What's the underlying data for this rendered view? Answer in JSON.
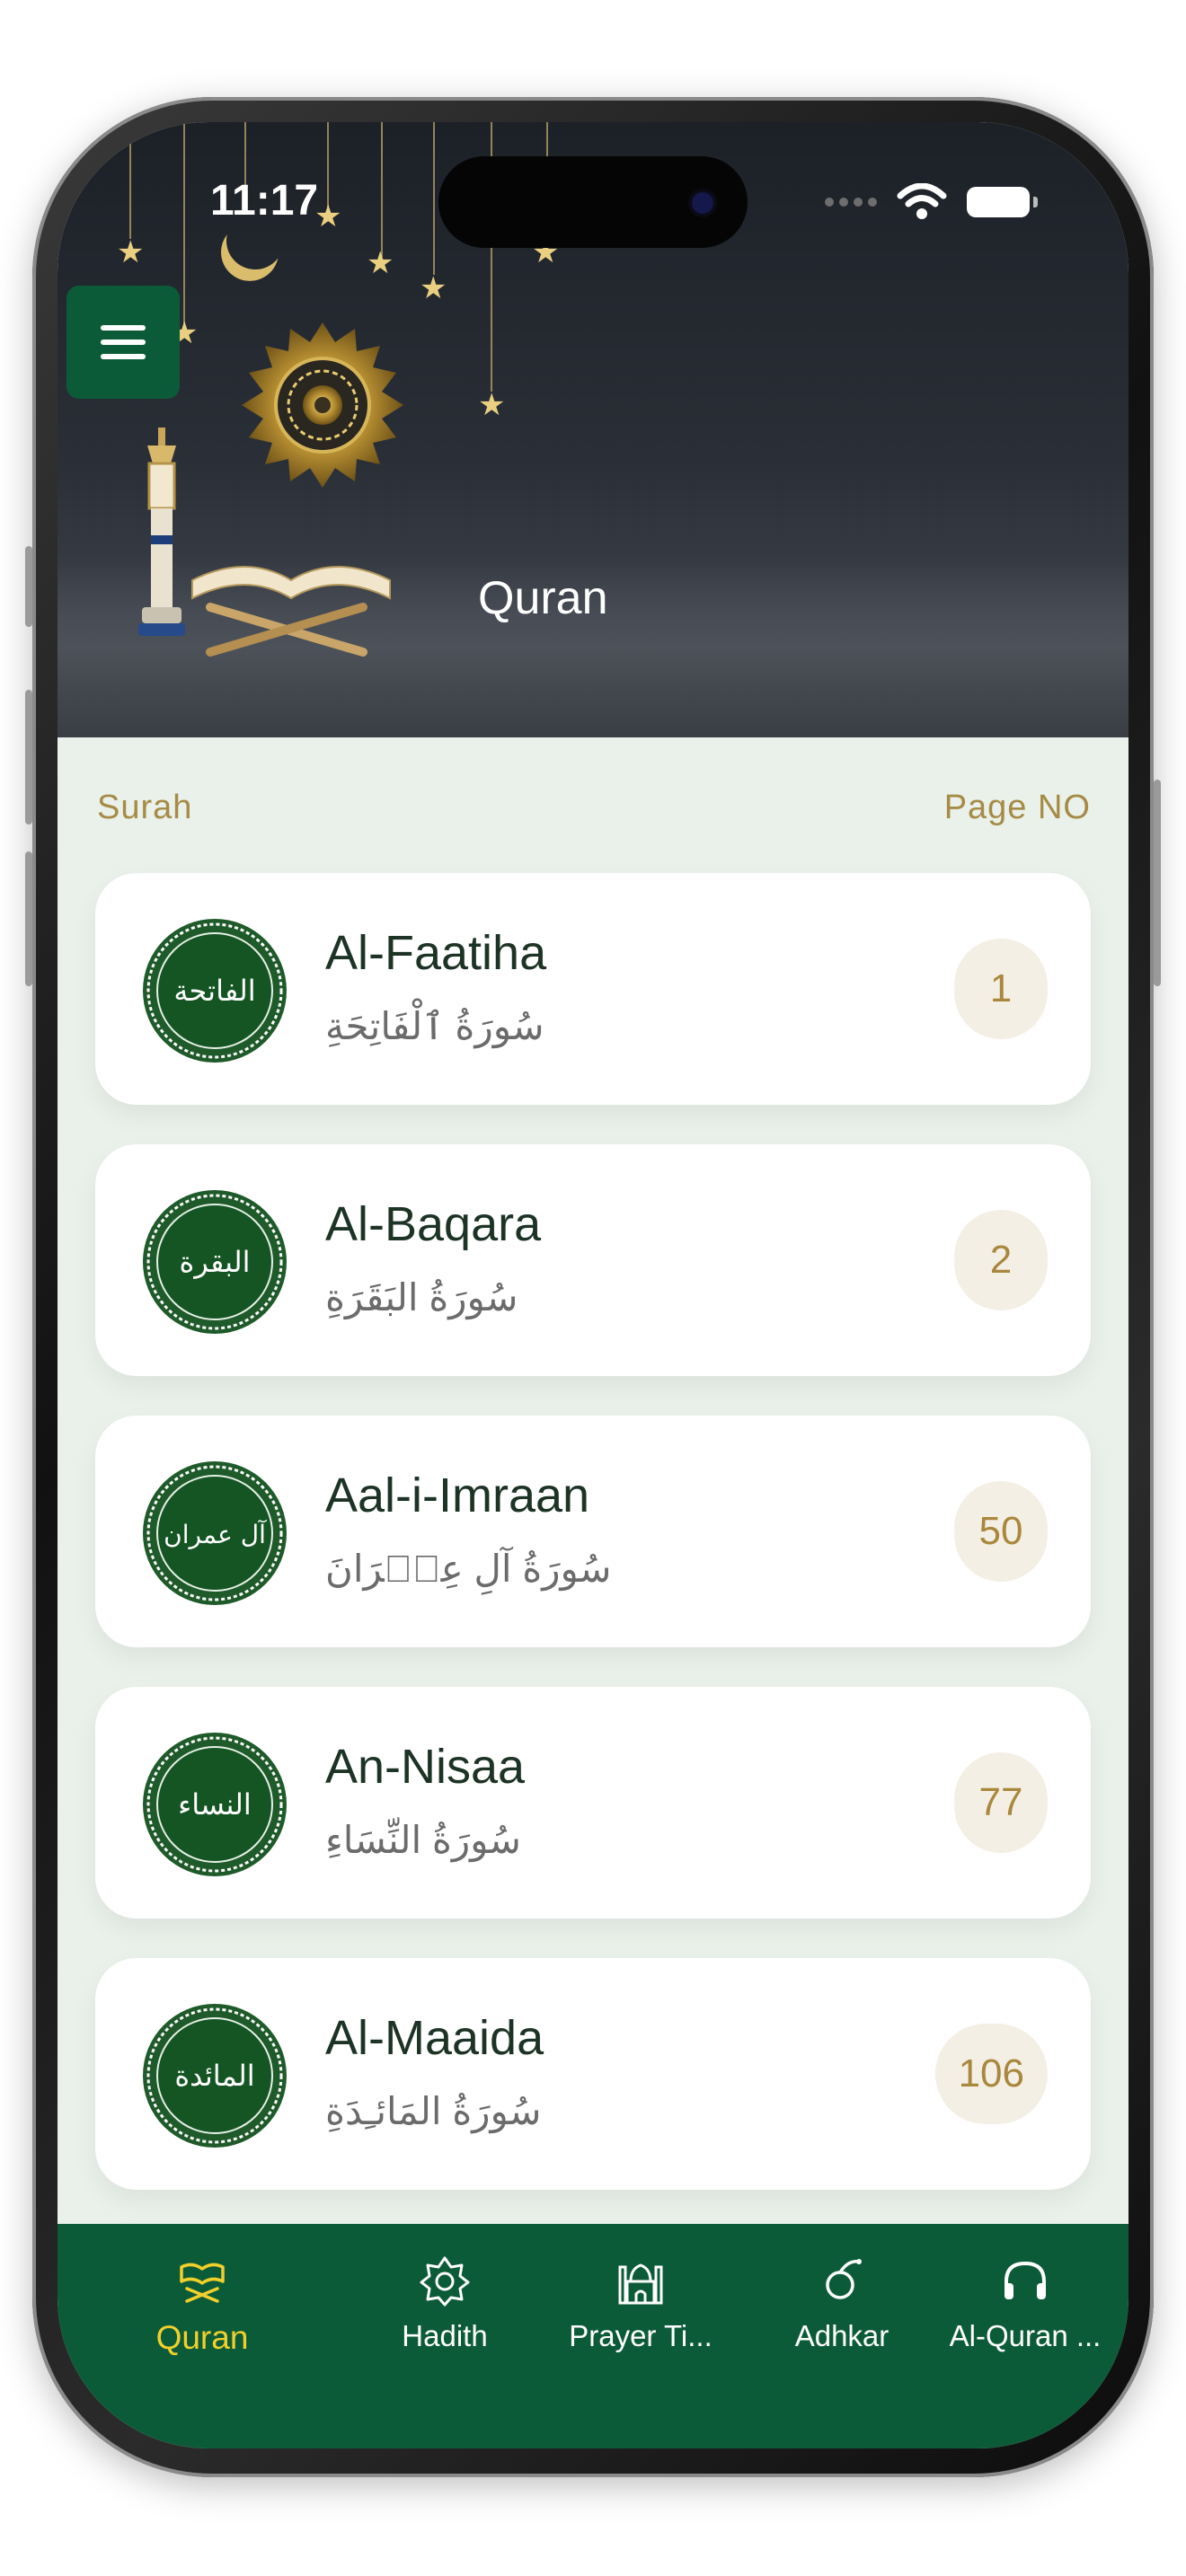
{
  "status_bar": {
    "time": "11:17"
  },
  "header": {
    "title": "Quran"
  },
  "list_header": {
    "left": "Surah",
    "right": "Page NO"
  },
  "surahs": [
    {
      "name": "Al-Faatiha",
      "arabic": "سُورَةُ ٱلْفَاتِحَةِ",
      "page": "1",
      "seal_text": "الفاتحة"
    },
    {
      "name": "Al-Baqara",
      "arabic": "سُورَةُ البَقَرَةِ",
      "page": "2",
      "seal_text": "البقرة"
    },
    {
      "name": "Aal-i-Imraan",
      "arabic": "سُورَةُ آلِ عِمۡرَانَ",
      "page": "50",
      "seal_text": "آل عمران"
    },
    {
      "name": "An-Nisaa",
      "arabic": "سُورَةُ النِّسَاءِ",
      "page": "77",
      "seal_text": "النساء"
    },
    {
      "name": "Al-Maaida",
      "arabic": "سُورَةُ المَائـِدَةِ",
      "page": "106",
      "seal_text": "المائدة"
    }
  ],
  "tabs": [
    {
      "label": "Quran",
      "icon": "quran-icon",
      "active": true
    },
    {
      "label": "Hadith",
      "icon": "hadith-icon",
      "active": false
    },
    {
      "label": "Prayer Ti...",
      "icon": "mosque-icon",
      "active": false
    },
    {
      "label": "Adhkar",
      "icon": "adhkar-icon",
      "active": false
    },
    {
      "label": "Al-Quran ...",
      "icon": "headphones-icon",
      "active": false
    }
  ],
  "colors": {
    "primary_green": "#0c5b38",
    "accent_gold": "#a68b46",
    "active_tab": "#f1d02b",
    "background": "#e9f1ea"
  }
}
